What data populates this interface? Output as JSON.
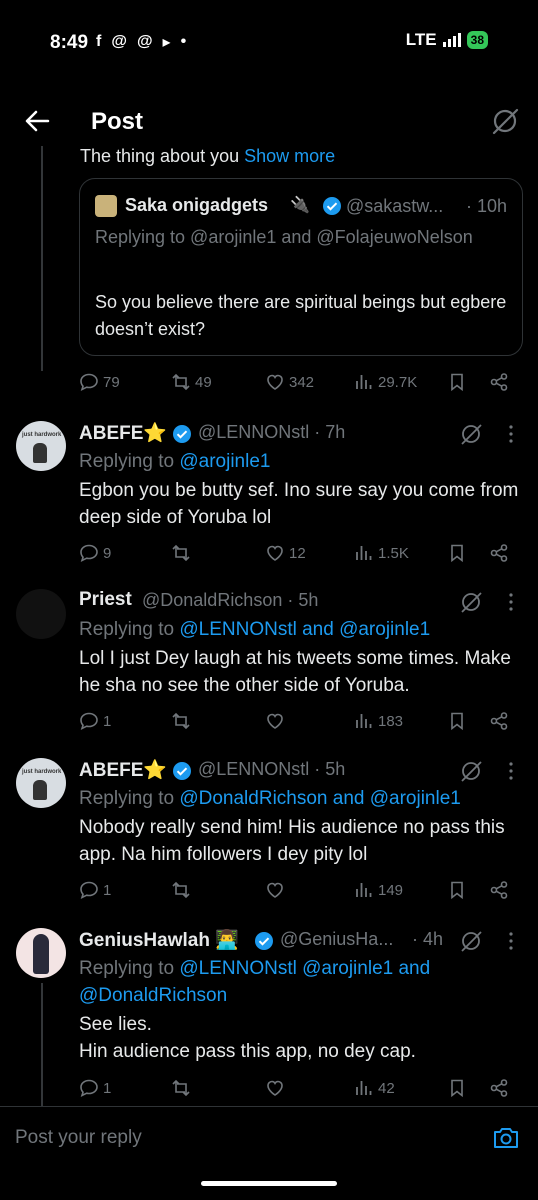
{
  "status_bar": {
    "time": "8:49",
    "network": "LTE",
    "battery": "38"
  },
  "header": {
    "title": "Post"
  },
  "parent": {
    "cut_text": "The thing about you",
    "show_more": "Show more",
    "quote": {
      "name": "Saka onigadgets",
      "emoji": "🔌",
      "handle": "@sakastw...",
      "time": "· 10h",
      "replying": "Replying to @arojinle1 and @FolajeuwoNelson",
      "text": "So you believe there are spiritual beings but egbere doesn’t exist?"
    },
    "stats": {
      "replies": "79",
      "reposts": "49",
      "likes": "342",
      "views": "29.7K"
    }
  },
  "replies": [
    {
      "name": "ABEFE⭐",
      "handle": "@LENNONstl · 7h",
      "replying_prefix": "Replying to",
      "replying_to": "@arojinle1",
      "text": "Egbon you be butty sef. Ino sure say you come from deep side of Yoruba lol",
      "stats": {
        "replies": "9",
        "reposts": "",
        "likes": "12",
        "views": "1.5K"
      }
    },
    {
      "name": "Priest",
      "handle": "@DonaldRichson · 5h",
      "replying_prefix": "Replying to",
      "replying_to": "@LENNONstl and @arojinle1",
      "text": "Lol I just Dey laugh at his tweets some times. Make he sha no see the other side of Yoruba.",
      "stats": {
        "replies": "1",
        "reposts": "",
        "likes": "",
        "views": "183"
      }
    },
    {
      "name": "ABEFE⭐",
      "handle": "@LENNONstl · 5h",
      "replying_prefix": "Replying to",
      "replying_to": "@DonaldRichson and @arojinle1",
      "text": "Nobody really send him! His audience no pass this app. Na him followers I dey pity lol",
      "stats": {
        "replies": "1",
        "reposts": "",
        "likes": "",
        "views": "149"
      }
    },
    {
      "name": "GeniusHawlah 👨‍💻",
      "handle": "@GeniusHa...",
      "time": "· 4h",
      "replying_prefix": "Replying to",
      "replying_to": "@LENNONstl @arojinle1 and @DonaldRichson",
      "text": "See lies.\nHin audience pass this app, no dey cap.",
      "stats": {
        "replies": "1",
        "reposts": "",
        "likes": "",
        "views": "42"
      }
    }
  ],
  "composer": {
    "placeholder": "Post your reply"
  },
  "avatar_labels": {
    "abefe": "just hardwork"
  },
  "colors": {
    "background": "#000000",
    "accent": "#1d9bf0",
    "muted": "#71767b",
    "text": "#e7e9ea"
  }
}
